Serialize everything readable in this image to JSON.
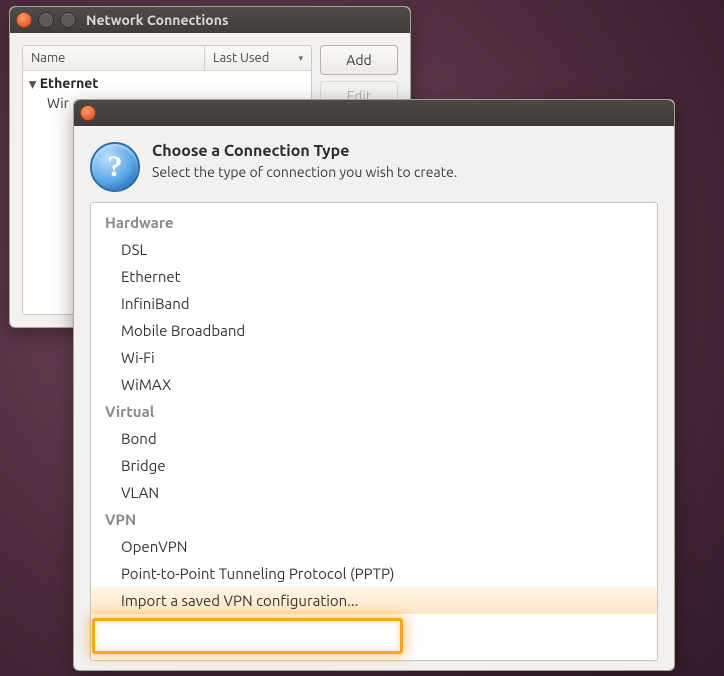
{
  "bg_window": {
    "title": "Network Connections",
    "columns": {
      "name": "Name",
      "last_used": "Last Used"
    },
    "group": "Ethernet",
    "item_partial": "Wir",
    "buttons": {
      "add": "Add",
      "edit": "Edit"
    }
  },
  "dialog": {
    "heading": "Choose a Connection Type",
    "subheading": "Select the type of connection you wish to create.",
    "sections": [
      {
        "label": "Hardware",
        "items": [
          "DSL",
          "Ethernet",
          "InfiniBand",
          "Mobile Broadband",
          "Wi-Fi",
          "WiMAX"
        ]
      },
      {
        "label": "Virtual",
        "items": [
          "Bond",
          "Bridge",
          "VLAN"
        ]
      },
      {
        "label": "VPN",
        "items": [
          "OpenVPN",
          "Point-to-Point Tunneling Protocol (PPTP)",
          "Import a saved VPN configuration..."
        ]
      }
    ],
    "highlighted": "Import a saved VPN configuration..."
  }
}
